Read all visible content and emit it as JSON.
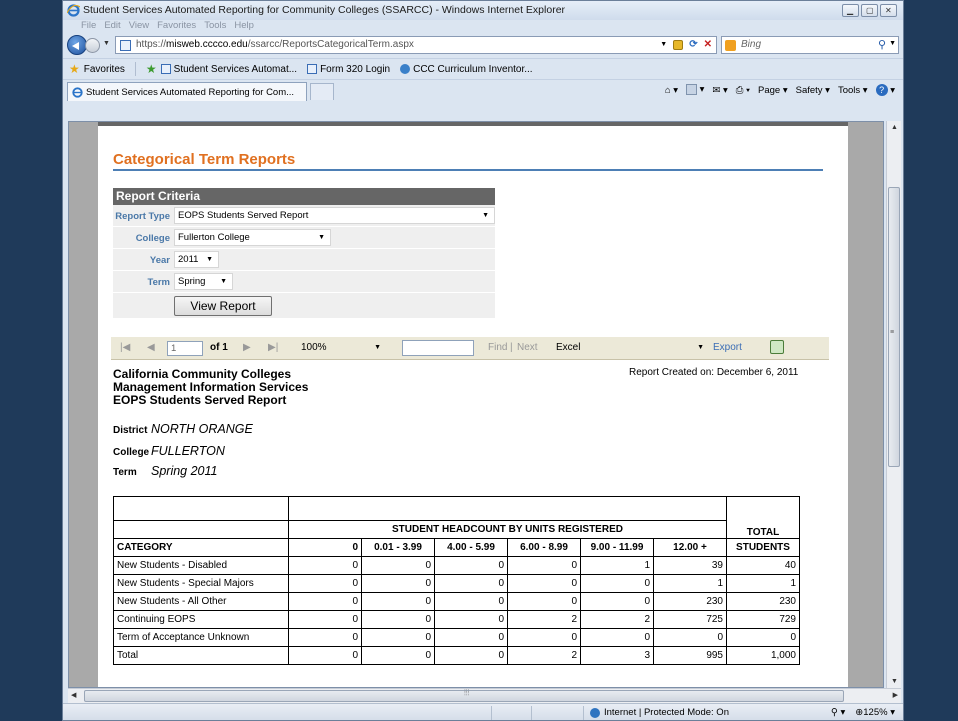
{
  "window": {
    "title": "Student Services Automated Reporting for Community Colleges (SSARCC) - Windows Internet Explorer"
  },
  "menu": [
    "File",
    "Edit",
    "View",
    "Favorites",
    "Tools",
    "Help"
  ],
  "address": {
    "url_prefix": "https://",
    "url_host": "misweb.cccco.edu",
    "url_path": "/ssarcc/ReportsCategoricalTerm.aspx",
    "search_placeholder": "Bing"
  },
  "favorites": {
    "label": "Favorites",
    "items": [
      "Student Services Automat...",
      "Form 320 Login",
      "CCC Curriculum Inventor..."
    ]
  },
  "tab": {
    "label": "Student Services Automated Reporting for Com..."
  },
  "commands": {
    "page": "Page",
    "safety": "Safety",
    "tools": "Tools"
  },
  "report_page": {
    "title": "Categorical Term Reports",
    "criteria_header": "Report Criteria",
    "criteria": [
      {
        "label": "Report Type",
        "value": "EOPS Students Served Report"
      },
      {
        "label": "College",
        "value": "Fullerton College"
      },
      {
        "label": "Year",
        "value": "2011"
      },
      {
        "label": "Term",
        "value": "Spring"
      }
    ],
    "view_button": "View Report"
  },
  "viewer_toolbar": {
    "page": "1",
    "of": "of 1",
    "zoom": "100%",
    "find": "Find",
    "pipe": "|",
    "next": "Next",
    "format": "Excel",
    "export": "Export"
  },
  "report": {
    "org_line1": "California Community Colleges",
    "org_line2": "Management Information Services",
    "org_line3": "EOPS Students Served Report",
    "created": "Report Created on: December 6, 2011",
    "district_label": "District",
    "district": "NORTH ORANGE",
    "college_label": "College",
    "college": "FULLERTON",
    "term_label": "Term",
    "term": "Spring 2011",
    "group_header": "STUDENT HEADCOUNT BY UNITS REGISTERED",
    "total_header_1": "TOTAL",
    "total_header_2": "STUDENTS",
    "category_header": "CATEGORY",
    "columns": [
      "0",
      "0.01 - 3.99",
      "4.00 - 5.99",
      "6.00 - 8.99",
      "9.00 - 11.99",
      "12.00 +"
    ],
    "rows": [
      {
        "category": "New Students - Disabled",
        "values": [
          "0",
          "0",
          "0",
          "0",
          "1",
          "39"
        ],
        "total": "40"
      },
      {
        "category": "New Students - Special Majors",
        "values": [
          "0",
          "0",
          "0",
          "0",
          "0",
          "1"
        ],
        "total": "1"
      },
      {
        "category": "New Students - All Other",
        "values": [
          "0",
          "0",
          "0",
          "0",
          "0",
          "230"
        ],
        "total": "230"
      },
      {
        "category": "Continuing EOPS",
        "values": [
          "0",
          "0",
          "0",
          "2",
          "2",
          "725"
        ],
        "total": "729"
      },
      {
        "category": "Term of Acceptance Unknown",
        "values": [
          "0",
          "0",
          "0",
          "0",
          "0",
          "0"
        ],
        "total": "0"
      },
      {
        "category": "Total",
        "values": [
          "0",
          "0",
          "0",
          "2",
          "3",
          "995"
        ],
        "total": "1,000"
      }
    ]
  },
  "status": {
    "zone": "Internet | Protected Mode: On",
    "zoom": "125%"
  }
}
